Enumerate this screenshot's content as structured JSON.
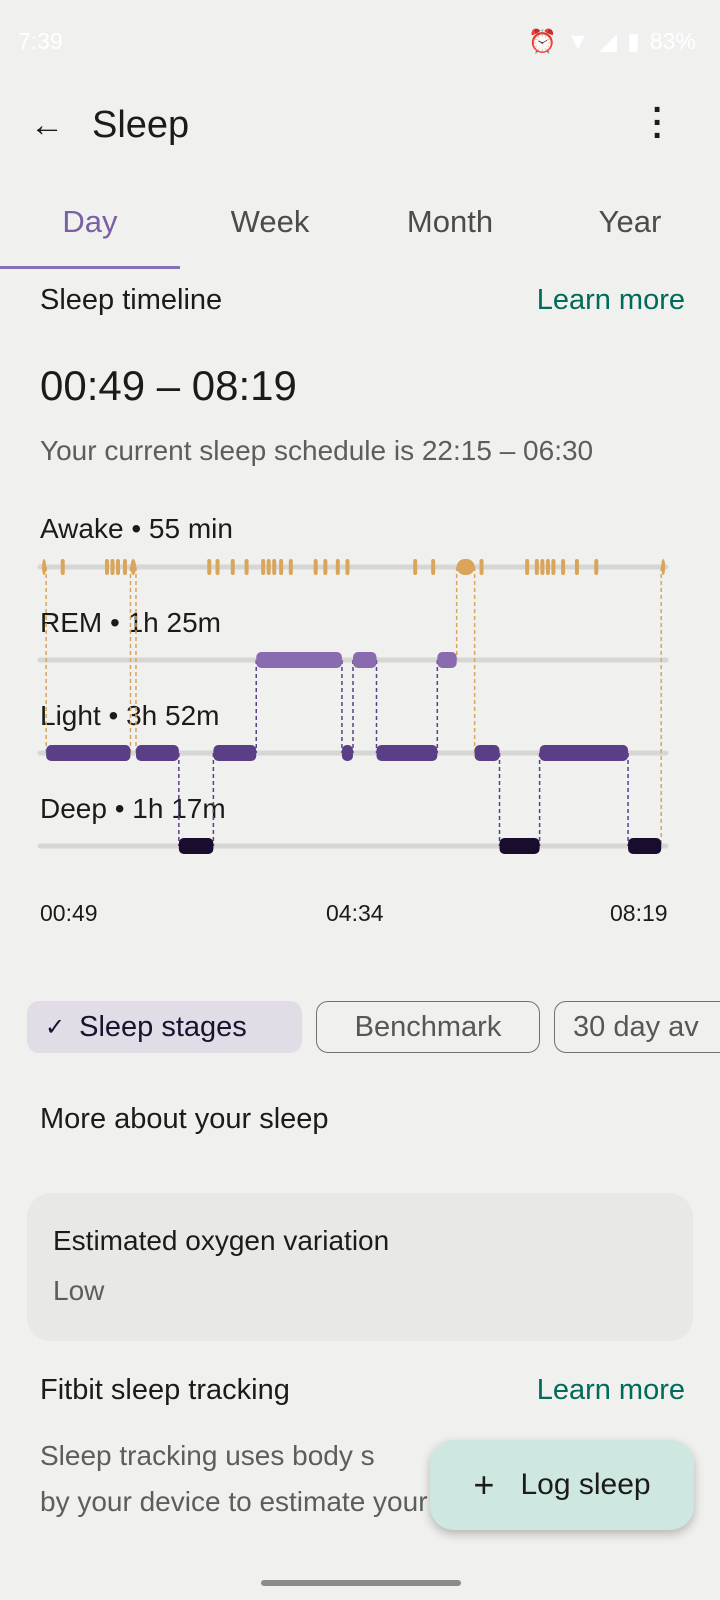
{
  "status_bar": {
    "time": "7:39",
    "battery": "83%",
    "icons": [
      "alarm-icon",
      "wifi-icon",
      "signal-icon",
      "battery-icon"
    ]
  },
  "header": {
    "title": "Sleep",
    "back_icon": "arrow-left-icon",
    "menu_icon": "more-vert-icon"
  },
  "tabs": [
    {
      "label": "Day",
      "active": true
    },
    {
      "label": "Week"
    },
    {
      "label": "Month"
    },
    {
      "label": "Year"
    }
  ],
  "timeline": {
    "title": "Sleep timeline",
    "learn_more": "Learn more",
    "range": "00:49 – 08:19",
    "schedule": "Your current sleep schedule is 22:15 – 06:30",
    "stages": {
      "awake": "Awake • 55 min",
      "rem": "REM • 1h 25m",
      "light": "Light • 3h 52m",
      "deep": "Deep • 1h 17m"
    },
    "axis": [
      "00:49",
      "04:34",
      "08:19"
    ]
  },
  "chart_data": {
    "type": "timeline",
    "x_range": [
      "00:49",
      "08:19"
    ],
    "levels": [
      "awake",
      "rem",
      "light",
      "deep"
    ],
    "colors": {
      "awake": "#d9a55a",
      "rem": "#8a6bb0",
      "light": "#5a3f86",
      "deep": "#1a0c2c"
    },
    "segments": [
      [
        "awake",
        "00:49",
        "00:52"
      ],
      [
        "light",
        "00:52",
        "01:53"
      ],
      [
        "awake",
        "01:53",
        "01:57"
      ],
      [
        "light",
        "01:57",
        "02:28"
      ],
      [
        "deep",
        "02:28",
        "02:53"
      ],
      [
        "light",
        "02:53",
        "03:24"
      ],
      [
        "rem",
        "03:24",
        "04:26"
      ],
      [
        "light",
        "04:26",
        "04:34"
      ],
      [
        "rem",
        "04:34",
        "04:51"
      ],
      [
        "light",
        "04:51",
        "05:35"
      ],
      [
        "rem",
        "05:35",
        "05:49"
      ],
      [
        "awake",
        "05:49",
        "06:02"
      ],
      [
        "light",
        "06:02",
        "06:20"
      ],
      [
        "deep",
        "06:20",
        "06:49"
      ],
      [
        "light",
        "06:49",
        "07:53"
      ],
      [
        "deep",
        "07:53",
        "08:17"
      ],
      [
        "awake",
        "08:17",
        "08:19"
      ]
    ],
    "awake_marks": [
      "01:04",
      "01:36",
      "01:40",
      "01:44",
      "01:49",
      "02:50",
      "02:56",
      "03:07",
      "03:17",
      "03:29",
      "03:33",
      "03:37",
      "03:42",
      "03:49",
      "04:07",
      "04:14",
      "04:23",
      "04:30",
      "05:19",
      "05:32",
      "06:07",
      "06:40",
      "06:47",
      "06:51",
      "06:55",
      "06:59",
      "07:06",
      "07:16",
      "07:30"
    ]
  },
  "chips": [
    {
      "label": "Sleep stages",
      "selected": true,
      "icon": "check-icon"
    },
    {
      "label": "Benchmark"
    },
    {
      "label": "30 day av"
    }
  ],
  "more": {
    "title": "More about your sleep",
    "card_title": "Estimated oxygen variation",
    "card_value": "Low"
  },
  "tracking": {
    "title": "Fitbit sleep tracking",
    "learn_more": "Learn more",
    "line1": "Sleep tracking uses body s",
    "line2": "by your device to estimate your sleep"
  },
  "fab": {
    "label": "Log sleep",
    "icon": "plus-icon"
  }
}
